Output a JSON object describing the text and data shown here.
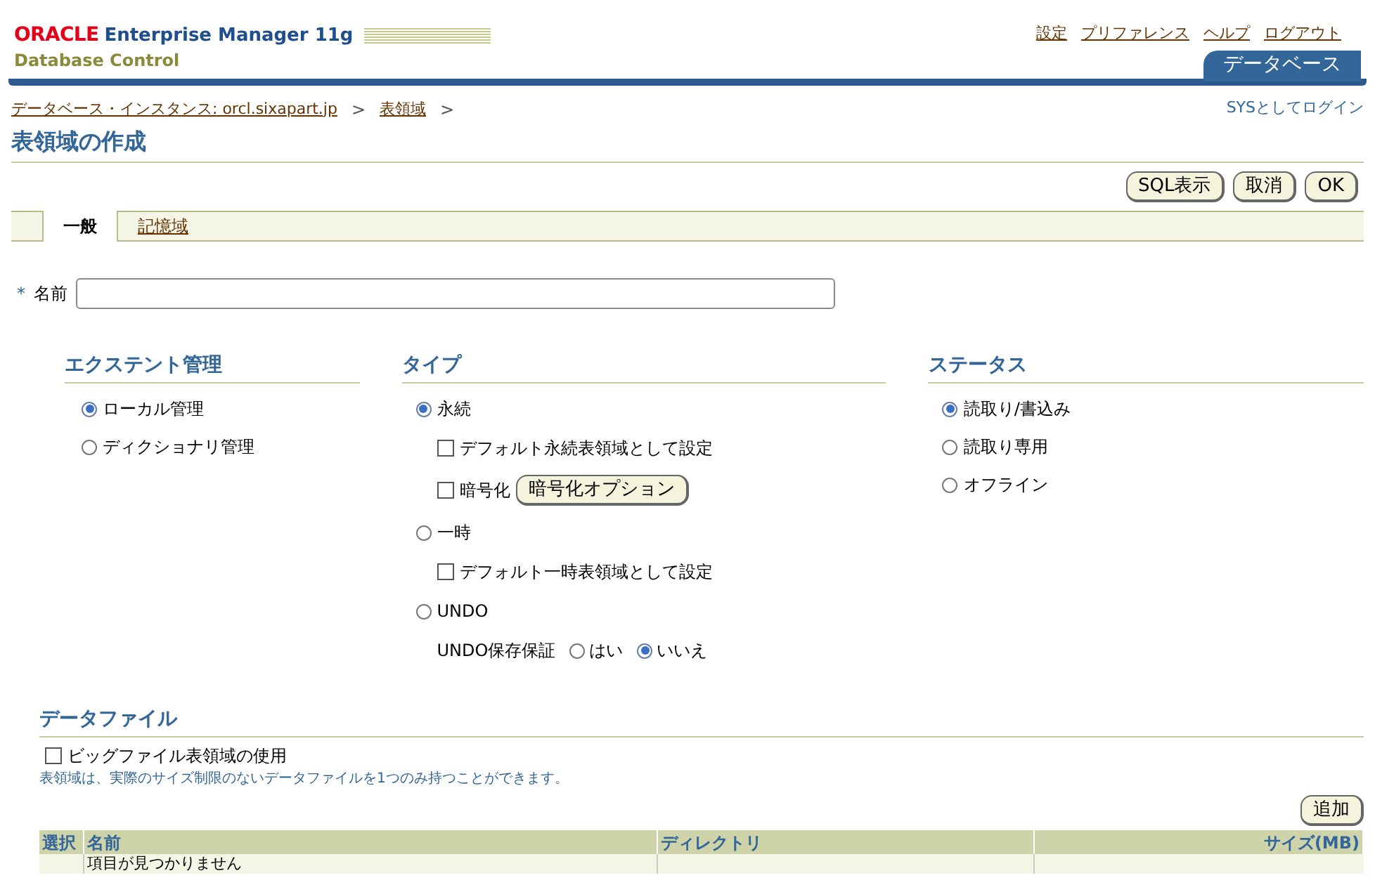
{
  "header": {
    "brand": "ORACLE",
    "product": "Enterprise Manager 11g",
    "subtitle": "Database Control",
    "links": [
      "設定",
      "プリファレンス",
      "ヘルプ",
      "ログアウト"
    ],
    "tabs": [
      {
        "label": "データベース",
        "selected": true
      }
    ]
  },
  "breadcrumb": {
    "items": [
      "データベース・インスタンス: orcl.sixapart.jp",
      "表領域"
    ],
    "separator": ">",
    "login": "SYSとしてログイン"
  },
  "page_title": "表領域の作成",
  "actions": [
    "SQL表示",
    "取消",
    "OK"
  ],
  "tabs": [
    {
      "label": "一般",
      "selected": true
    },
    {
      "label": "記憶域",
      "selected": false
    }
  ],
  "name_field": {
    "required_mark": "*",
    "label": "名前"
  },
  "extent": {
    "heading": "エクステント管理",
    "options": [
      {
        "label": "ローカル管理",
        "selected": true
      },
      {
        "label": "ディクショナリ管理",
        "selected": false
      }
    ]
  },
  "type": {
    "heading": "タイプ",
    "options": [
      {
        "label": "永続",
        "selected": true,
        "sub": [
          {
            "kind": "checkbox",
            "label": "デフォルト永続表領域として設定",
            "checked": false
          },
          {
            "kind": "checkbox_button",
            "label": "暗号化",
            "checked": false,
            "button": "暗号化オプション"
          }
        ]
      },
      {
        "label": "一時",
        "selected": false,
        "sub": [
          {
            "kind": "checkbox",
            "label": "デフォルト一時表領域として設定",
            "checked": false
          }
        ]
      },
      {
        "label": "UNDO",
        "selected": false,
        "sub": [
          {
            "kind": "radio_group",
            "label": "UNDO保存保証",
            "choices": [
              {
                "label": "はい",
                "selected": false
              },
              {
                "label": "いいえ",
                "selected": true
              }
            ]
          }
        ]
      }
    ]
  },
  "status": {
    "heading": "ステータス",
    "options": [
      {
        "label": "読取り/書込み",
        "selected": true
      },
      {
        "label": "読取り専用",
        "selected": false
      },
      {
        "label": "オフライン",
        "selected": false
      }
    ]
  },
  "datafiles": {
    "heading": "データファイル",
    "bigfile": {
      "label": "ビッグファイル表領域の使用",
      "checked": false
    },
    "hint": "表領域は、実際のサイズ制限のないデータファイルを1つのみ持つことができます。",
    "add_button": "追加",
    "columns": [
      "選択",
      "名前",
      "ディレクトリ",
      "サイズ(MB)"
    ],
    "empty_message": "項目が見つかりません"
  }
}
